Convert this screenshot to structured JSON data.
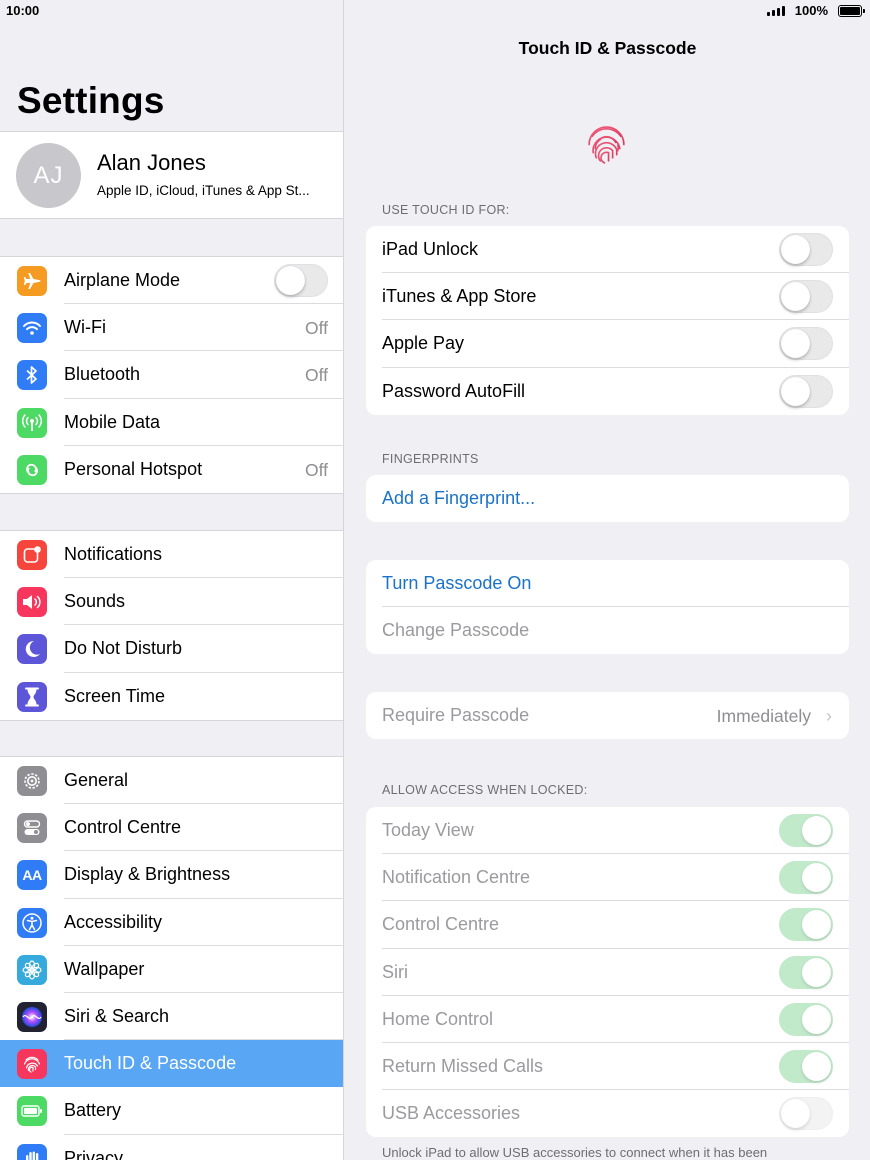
{
  "status": {
    "time": "10:00",
    "battery": "100%"
  },
  "master": {
    "title": "Settings",
    "profile": {
      "initials": "AJ",
      "name": "Alan Jones",
      "subtitle": "Apple ID, iCloud, iTunes & App St..."
    },
    "group1": [
      {
        "label": "Airplane Mode",
        "icon": "airplane-icon",
        "color": "#f59b21",
        "toggle": false
      },
      {
        "label": "Wi-Fi",
        "icon": "wifi-icon",
        "color": "#2f7cf6",
        "value": "Off"
      },
      {
        "label": "Bluetooth",
        "icon": "bluetooth-icon",
        "color": "#2f7cf6",
        "value": "Off"
      },
      {
        "label": "Mobile Data",
        "icon": "antenna-icon",
        "color": "#4cd964"
      },
      {
        "label": "Personal Hotspot",
        "icon": "hotspot-icon",
        "color": "#4cd964",
        "value": "Off"
      }
    ],
    "group2": [
      {
        "label": "Notifications",
        "icon": "notifications-icon",
        "color": "#f6453d"
      },
      {
        "label": "Sounds",
        "icon": "speaker-icon",
        "color": "#f6365d"
      },
      {
        "label": "Do Not Disturb",
        "icon": "moon-icon",
        "color": "#5e56d8"
      },
      {
        "label": "Screen Time",
        "icon": "hourglass-icon",
        "color": "#5e56d8"
      }
    ],
    "group3": [
      {
        "label": "General",
        "icon": "gear-icon",
        "color": "#8e8e93"
      },
      {
        "label": "Control Centre",
        "icon": "switches-icon",
        "color": "#8e8e93"
      },
      {
        "label": "Display & Brightness",
        "icon": "text-size-icon",
        "color": "#2f7cf6"
      },
      {
        "label": "Accessibility",
        "icon": "accessibility-icon",
        "color": "#2f7cf6"
      },
      {
        "label": "Wallpaper",
        "icon": "flower-icon",
        "color": "#36aadc"
      },
      {
        "label": "Siri & Search",
        "icon": "siri-icon",
        "color": "#222233"
      },
      {
        "label": "Touch ID & Passcode",
        "icon": "fingerprint-icon",
        "color": "#f6365d",
        "selected": true
      },
      {
        "label": "Battery",
        "icon": "battery-icon",
        "color": "#4cd964"
      },
      {
        "label": "Privacy",
        "icon": "hand-icon",
        "color": "#2f7cf6"
      }
    ]
  },
  "detail": {
    "title": "Touch ID & Passcode",
    "touch_id_header": "USE TOUCH ID FOR:",
    "touch_id_rows": [
      {
        "label": "iPad Unlock",
        "toggle": false
      },
      {
        "label": "iTunes & App Store",
        "toggle": false
      },
      {
        "label": "Apple Pay",
        "toggle": false
      },
      {
        "label": "Password AutoFill",
        "toggle": false
      }
    ],
    "fingerprints_header": "FINGERPRINTS",
    "add_fingerprint": "Add a Fingerprint...",
    "turn_passcode_on": "Turn Passcode On",
    "change_passcode": "Change Passcode",
    "require_passcode": {
      "label": "Require Passcode",
      "value": "Immediately"
    },
    "allow_header": "ALLOW ACCESS WHEN LOCKED:",
    "allow_rows": [
      {
        "label": "Today View",
        "toggle": true
      },
      {
        "label": "Notification Centre",
        "toggle": true
      },
      {
        "label": "Control Centre",
        "toggle": true
      },
      {
        "label": "Siri",
        "toggle": true
      },
      {
        "label": "Home Control",
        "toggle": true
      },
      {
        "label": "Return Missed Calls",
        "toggle": true
      },
      {
        "label": "USB Accessories",
        "toggle": false
      }
    ],
    "footnote": "Unlock iPad to allow USB accessories to connect when it has been"
  }
}
